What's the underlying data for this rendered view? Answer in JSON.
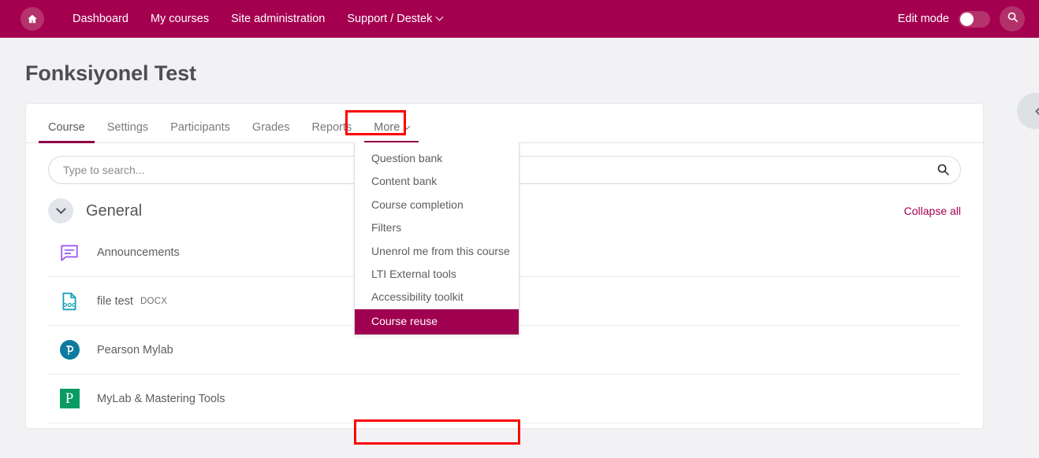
{
  "navbar": {
    "home_icon": "home-icon",
    "links": [
      {
        "label": "Dashboard",
        "has_caret": false
      },
      {
        "label": "My courses",
        "has_caret": false
      },
      {
        "label": "Site administration",
        "has_caret": false
      },
      {
        "label": "Support / Destek",
        "has_caret": true
      }
    ],
    "edit_mode_label": "Edit mode",
    "edit_mode_on": false,
    "search_icon": "search-icon",
    "background_color": "#A50050"
  },
  "page": {
    "title": "Fonksiyonel Test",
    "drawer_toggle_icon": "chevron-left-icon"
  },
  "tabs": [
    {
      "label": "Course",
      "active": true
    },
    {
      "label": "Settings",
      "active": false
    },
    {
      "label": "Participants",
      "active": false
    },
    {
      "label": "Grades",
      "active": false
    },
    {
      "label": "Reports",
      "active": false
    }
  ],
  "more_tab": {
    "label": "More",
    "caret_icon": "chevron-down-icon",
    "expanded": true,
    "highlight_color": "#ff0000"
  },
  "dropdown": {
    "items": [
      {
        "label": "Question bank",
        "selected": false
      },
      {
        "label": "Content bank",
        "selected": false
      },
      {
        "label": "Course completion",
        "selected": false
      },
      {
        "label": "Filters",
        "selected": false
      },
      {
        "label": "Unenrol me from this course",
        "selected": false
      },
      {
        "label": "LTI External tools",
        "selected": false
      },
      {
        "label": "Accessibility toolkit",
        "selected": false
      },
      {
        "label": "Course reuse",
        "selected": true
      }
    ],
    "selected_background": "#A00050",
    "highlight_color": "#ff0000"
  },
  "search": {
    "placeholder": "Type to search...",
    "value": "",
    "icon": "search-icon"
  },
  "section": {
    "toggle_icon": "chevron-down-icon",
    "title": "General",
    "collapse_all_label": "Collapse all"
  },
  "activities": [
    {
      "name": "Announcements",
      "sub": "",
      "icon": "forum-icon"
    },
    {
      "name": "file test",
      "sub": "DOCX",
      "icon": "doc-file-icon"
    },
    {
      "name": "Pearson Mylab",
      "sub": "",
      "icon": "pearson-logo-icon"
    },
    {
      "name": "MyLab & Mastering Tools",
      "sub": "",
      "icon": "mylab-logo-icon"
    }
  ]
}
